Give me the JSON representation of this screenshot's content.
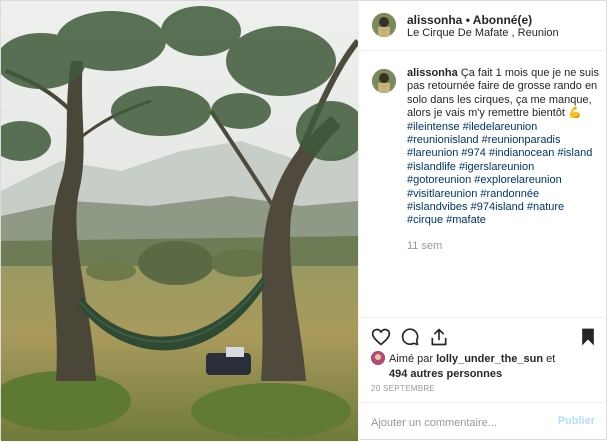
{
  "post": {
    "username": "alissonha",
    "separator": "•",
    "follow_status": "Abonné(e)",
    "location": "Le Cirque De Mafate , Reunion"
  },
  "caption": {
    "username": "alissonha",
    "text": "Ça fait 1 mois que je ne suis pas retournée faire de grosse rando en solo dans les cirques, ça me manque, alors je vais m'y remettre bientôt",
    "emoji": "💪",
    "hashtags": "#ileintense #iledelareunion #reunionisland #reunionparadis #lareunion #974 #indianocean #island #islandlife #igerslareunion #gotoreunion #explorelareunion #visitlareunion #randonnée #islandvibes #974island #nature #cirque #mafate"
  },
  "time_ago": "11 sem",
  "likes": {
    "prefix": "Aimé par",
    "user": "lolly_under_the_sun",
    "connector": "et",
    "others": "494 autres personnes"
  },
  "date": "20 SEPTEMBRE",
  "comment": {
    "placeholder": "Ajouter un commentaire...",
    "publish_label": "Publier"
  },
  "icons": {
    "like": "heart-icon",
    "comment": "comment-bubble-icon",
    "share": "share-icon",
    "save": "bookmark-icon"
  },
  "colors": {
    "hashtag": "#003569",
    "muted": "#999999",
    "publish": "#b2dffc",
    "text": "#262626"
  }
}
